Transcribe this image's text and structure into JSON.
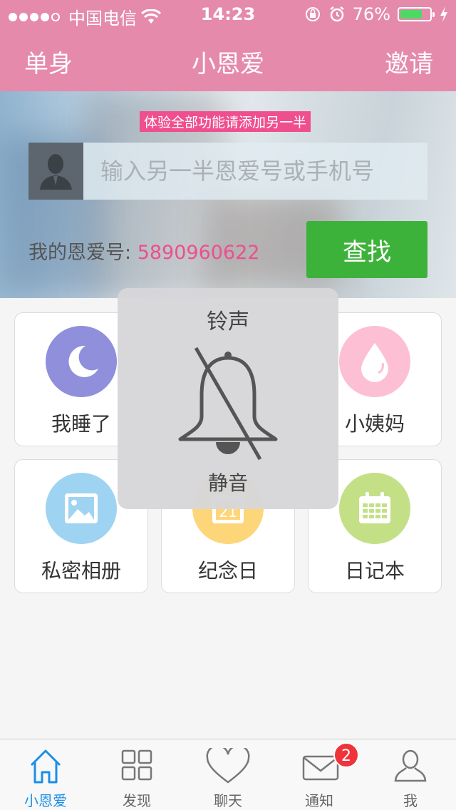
{
  "status_bar": {
    "carrier": "中国电信",
    "time": "14:23",
    "battery": "76%",
    "battery_level": 0.76
  },
  "nav": {
    "left": "单身",
    "title": "小恩爱",
    "right": "邀请"
  },
  "banner": {
    "tip": "体验全部功能请添加另一半",
    "search_placeholder": "输入另一半恩爱号或手机号",
    "my_id_label": "我的恩爱号: ",
    "my_id_value": "5890960622",
    "find_button": "查找"
  },
  "tiles": [
    {
      "label": "我睡了",
      "icon": "moon-icon",
      "color": "#8f8fdc"
    },
    {
      "label": "",
      "icon": "",
      "color": "#f2a7b9"
    },
    {
      "label": "小姨妈",
      "icon": "drop-icon",
      "color": "#fdbfd3"
    },
    {
      "label": "私密相册",
      "icon": "photo-icon",
      "color": "#9fd3f2"
    },
    {
      "label": "纪念日",
      "icon": "calendar-21-icon",
      "color": "#fed67a"
    },
    {
      "label": "日记本",
      "icon": "diary-calendar-icon",
      "color": "#c4e087"
    }
  ],
  "hud": {
    "title": "铃声",
    "status": "静音",
    "icon": "bell-muted-icon"
  },
  "tabbar": {
    "items": [
      {
        "label": "小恩爱",
        "icon": "home-icon",
        "active": true
      },
      {
        "label": "发现",
        "icon": "grid-icon",
        "active": false
      },
      {
        "label": "聊天",
        "icon": "heart-icon",
        "active": false
      },
      {
        "label": "通知",
        "icon": "mail-icon",
        "active": false,
        "badge": "2"
      },
      {
        "label": "我",
        "icon": "user-icon",
        "active": false
      }
    ]
  },
  "colors": {
    "nav_bg": "#e58aab",
    "accent_pink": "#ec4f8e",
    "find_button": "#3db23a",
    "tab_active": "#1a8fe8",
    "badge": "#f0333a"
  }
}
